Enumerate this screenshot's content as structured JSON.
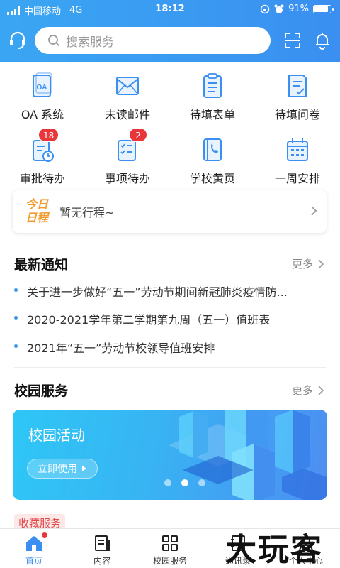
{
  "status": {
    "carrier": "中国移动",
    "network": "4G",
    "time": "18:12",
    "battery": "91%"
  },
  "search": {
    "placeholder": "搜索服务"
  },
  "grid": [
    {
      "label": "OA 系统",
      "icon": "oa-system-icon"
    },
    {
      "label": "未读邮件",
      "icon": "mail-icon"
    },
    {
      "label": "待填表单",
      "icon": "form-icon"
    },
    {
      "label": "待填问卷",
      "icon": "questionnaire-icon"
    },
    {
      "label": "审批待办",
      "icon": "approval-icon",
      "badge": "18"
    },
    {
      "label": "事项待办",
      "icon": "todo-icon",
      "badge": "2"
    },
    {
      "label": "学校黄页",
      "icon": "phonebook-icon"
    },
    {
      "label": "一周安排",
      "icon": "calendar-icon"
    }
  ],
  "today": {
    "tag_line1": "今日",
    "tag_line2": "日程",
    "text": "暂无行程~"
  },
  "notices": {
    "title": "最新通知",
    "more": "更多",
    "items": [
      "关于进一步做好“五一”劳动节期间新冠肺炎疫情防...",
      "2020-2021学年第二学期第九周（五一）值班表",
      "2021年“五一”劳动节校领导值班安排"
    ]
  },
  "campus": {
    "title": "校园服务",
    "more": "更多",
    "banner_title": "校园活动",
    "banner_button": "立即使用",
    "slides": 3,
    "active_slide": 2
  },
  "favorites": {
    "label": "收藏服务"
  },
  "tabs": [
    {
      "label": "首页",
      "icon": "home-icon",
      "active": true
    },
    {
      "label": "内容",
      "icon": "content-icon"
    },
    {
      "label": "校园服务",
      "icon": "grid-icon"
    },
    {
      "label": "通讯录",
      "icon": "contacts-icon"
    },
    {
      "label": "个人中心",
      "icon": "profile-icon"
    }
  ],
  "watermark": "大玩客",
  "colors": {
    "primary": "#3a8ff0",
    "badge": "#e8373a",
    "today_tag": "#f29a2e"
  }
}
